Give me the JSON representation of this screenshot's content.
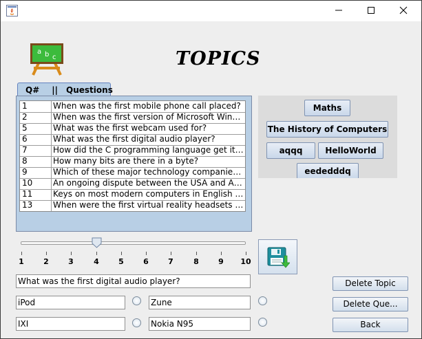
{
  "window": {
    "minimize_icon": "minimize-icon",
    "maximize_icon": "maximize-icon",
    "close_icon": "close-icon"
  },
  "page": {
    "heading": "TOPICS",
    "logo_text": {
      "a": "a",
      "b": "b",
      "c": "c"
    }
  },
  "questions_tab": {
    "col_num": "Q#",
    "separator": "||",
    "col_questions": "Questions",
    "rows": [
      {
        "num": "1",
        "text": "When was the first mobile phone call placed?"
      },
      {
        "num": "2",
        "text": "When was the first version of Microsoft Window..."
      },
      {
        "num": "5",
        "text": "What was the first webcam used for?"
      },
      {
        "num": "6",
        "text": "What was the first digital audio player?"
      },
      {
        "num": "7",
        "text": "How did the C programming language get its na..."
      },
      {
        "num": "8",
        "text": "How many bits are there in a byte?"
      },
      {
        "num": "9",
        "text": "Which of these major technology companies ha..."
      },
      {
        "num": "10",
        "text": "An ongoing dispute between the USA and Anti..."
      },
      {
        "num": "11",
        "text": "Keys on most modern computers in English spea..."
      },
      {
        "num": "13",
        "text": "When were the first virtual reality headsets dev..."
      }
    ]
  },
  "topics": [
    "Maths",
    "The History of Computers",
    "aqqq",
    "HelloWorld",
    "eededddq"
  ],
  "slider": {
    "labels": [
      "1",
      "2",
      "3",
      "4",
      "5",
      "6",
      "7",
      "8",
      "9",
      "10"
    ],
    "value": 4
  },
  "question_field": "What was the first digital audio player?",
  "answers": [
    "iPod",
    "Zune",
    "IXI",
    "Nokia N95"
  ],
  "buttons": {
    "delete_topic": "Delete Topic",
    "delete_question": "Delete Que...",
    "back": "Back",
    "save_icon": "floppy-disk-icon"
  },
  "colors": {
    "tab_blue": "#b8cfe5",
    "chalkboard_green": "#3cbb3c",
    "easel_orange": "#d98b1a",
    "save_teal": "#1e8f9e"
  }
}
